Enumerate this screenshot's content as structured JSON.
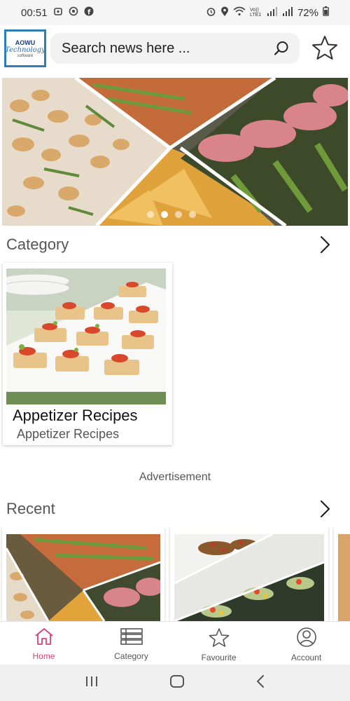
{
  "status_bar": {
    "time": "00:51",
    "network": "Vo)) LTE1",
    "battery": "72%"
  },
  "header": {
    "logo": {
      "line1": "AOWU",
      "line2": "Technology",
      "line3": "software"
    },
    "search_placeholder": "Search news here ...",
    "search_icon": "search-icon",
    "favourite_icon": "star-icon"
  },
  "banner": {
    "slide_count": 4,
    "active_index": 1
  },
  "category_section": {
    "title": "Category",
    "items": [
      {
        "title": "Appetizer Recipes",
        "subtitle": "Appetizer Recipes"
      }
    ]
  },
  "advertisement": {
    "label": "Advertisement"
  },
  "recent_section": {
    "title": "Recent"
  },
  "bottom_nav": {
    "items": [
      {
        "label": "Home",
        "icon": "home-icon",
        "active": true
      },
      {
        "label": "Category",
        "icon": "list-icon",
        "active": false
      },
      {
        "label": "Favourite",
        "icon": "star-icon",
        "active": false
      },
      {
        "label": "Account",
        "icon": "account-icon",
        "active": false
      }
    ]
  },
  "colors": {
    "accent": "#d9437a",
    "logo_border": "#2e7fb8"
  }
}
